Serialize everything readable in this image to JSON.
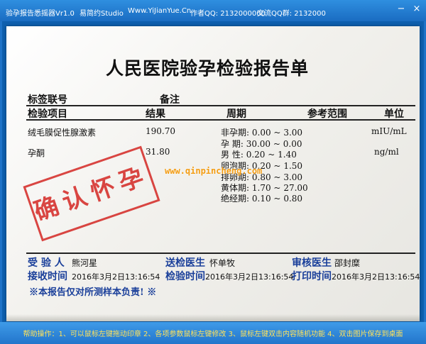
{
  "titlebar": {
    "app_name": "验孕报告悉摇器Vr1.0",
    "studio": "易简约Studio",
    "website": "Www.YiJianYue.Cn",
    "author_qq": "作者QQ: 2132000000",
    "group_qq": "交流QQ群: 2132000",
    "minimize_icon": "−",
    "close_icon": "×"
  },
  "report": {
    "title": "人民医院验孕检验报告单",
    "label_id": "标签联号",
    "remark": "备注",
    "headers": {
      "item": "检验项目",
      "result": "结果",
      "period": "周期",
      "reference": "参考范围",
      "unit": "单位"
    },
    "rows": [
      {
        "item": "绒毛膜促性腺激素",
        "result": "190.70",
        "unit": "mIU/mL"
      },
      {
        "item": "孕酮",
        "result": "31.80",
        "unit": "ng/ml"
      }
    ],
    "ranges": [
      {
        "label": "非孕期:",
        "low": "0.00",
        "high": "3.00"
      },
      {
        "label": "孕 期:",
        "low": "30.00",
        "high": "0.00"
      },
      {
        "label": "男 性:",
        "low": "0.20",
        "high": "1.40"
      },
      {
        "label": "卵泡期:",
        "low": "0.20",
        "high": "1.50"
      },
      {
        "label": "排卵期:",
        "low": "0.80",
        "high": "3.00"
      },
      {
        "label": "黄体期:",
        "low": "1.70",
        "high": "27.00"
      },
      {
        "label": "绝经期:",
        "low": "0.10",
        "high": "0.80"
      }
    ],
    "tilde": "~",
    "stamp": "确认怀孕",
    "watermark": "www.qinpincheng.com",
    "footer": {
      "receiver_label": "受 验 人",
      "receiver": "熊河星",
      "doctor_label": "送检医生",
      "doctor": "怀单牧",
      "reviewer_label": "审核医生",
      "reviewer": "邵封糜",
      "receive_time_label": "接收时间",
      "receive_time": "2016年3月2日13:16:54",
      "test_time_label": "检验时间",
      "test_time": "2016年3月2日13:16:54",
      "print_time_label": "打印时间",
      "print_time": "2016年3月2日13:16:54",
      "disclaimer": "※本报告仅对所测样本负责! ※"
    }
  },
  "statusbar": {
    "help": "帮助操作：1、可以鼠标左键拖动印章   2、各项参数鼠标左键修改   3、鼠标左键双击内容随机功能   4、双击图片保存到桌面"
  }
}
